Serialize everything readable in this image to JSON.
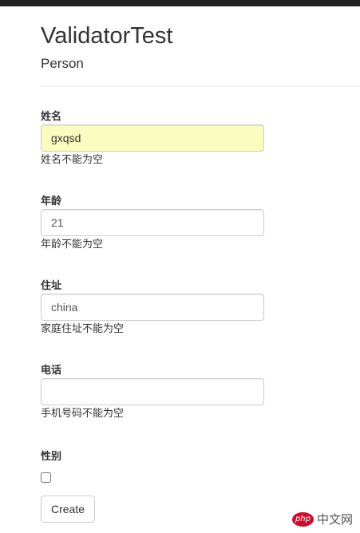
{
  "header": {
    "title": "ValidatorTest",
    "subtitle": "Person"
  },
  "form": {
    "name": {
      "label": "姓名",
      "value": "gxqsd",
      "placeholder": "",
      "help": "姓名不能为空"
    },
    "age": {
      "label": "年龄",
      "value": "21",
      "placeholder": "",
      "help": "年龄不能为空"
    },
    "address": {
      "label": "住址",
      "value": "china",
      "placeholder": "",
      "help": "家庭住址不能为空"
    },
    "phone": {
      "label": "电话",
      "value": "",
      "placeholder": "",
      "help": "手机号码不能为空"
    },
    "gender": {
      "label": "性别",
      "checked": false
    },
    "create_label": "Create"
  },
  "watermark": {
    "text": "中文网",
    "logo_color": "#c8102e"
  }
}
